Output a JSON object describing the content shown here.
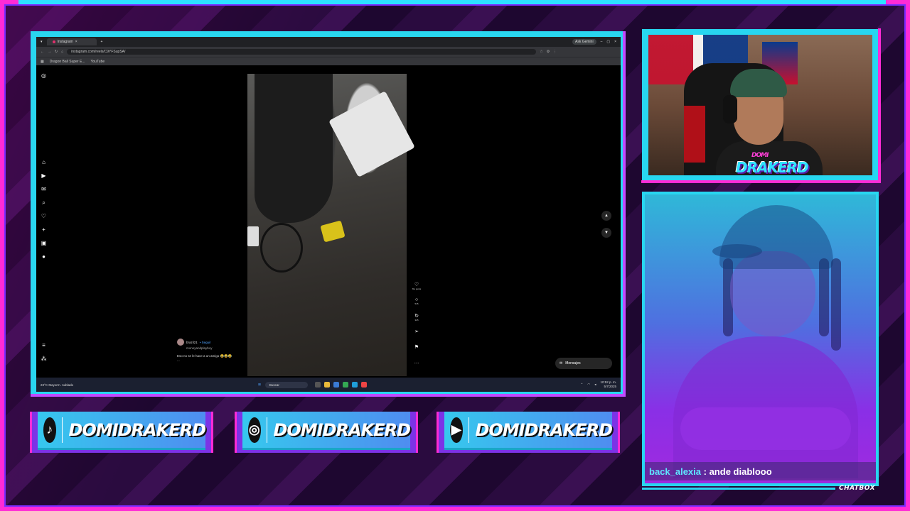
{
  "browser": {
    "tab_title": "Instagram",
    "gemini_label": "Ask Gemini",
    "url": "instagram.com/reels/C9YFSupSA/",
    "bookmarks": [
      "Dragon Ball Super E...",
      "YouTube"
    ]
  },
  "instagram": {
    "caption_user": "brazil21",
    "caption_follow": "• Seguir",
    "caption_audio": "moneyandplayboy",
    "caption_text": "Eso no se le hace a un amigo 😂😂😂",
    "caption_more": "...",
    "action_like_label": "Me gusta",
    "action_comment_count": "545",
    "action_share_count": "325",
    "messages_label": "Mensajes"
  },
  "taskbar": {
    "weather_temp": "23°C",
    "weather_desc": "Mayorm. nublado",
    "search_placeholder": "Buscar",
    "clock_time": "10:52 p. m.",
    "clock_date": "5/7/2025"
  },
  "social": [
    {
      "platform": "tiktok",
      "icon": "tiktok-icon",
      "handle": "DOMIDRAKERD"
    },
    {
      "platform": "instagram",
      "icon": "instagram-icon",
      "handle": "DOMIDRAKERD"
    },
    {
      "platform": "youtube",
      "icon": "youtube-icon",
      "handle": "DOMIDRAKERD"
    }
  ],
  "webcam": {
    "logo_top": "DOMI",
    "logo_main": "DRAKERD"
  },
  "chat": {
    "username": "back_alexia",
    "separator": " : ",
    "message": "ande diablooo",
    "label": "CHATBOX"
  },
  "colors": {
    "accent_cyan": "#28d6f0",
    "accent_pink": "#ff2bd6",
    "accent_purple": "#7c33e6"
  }
}
